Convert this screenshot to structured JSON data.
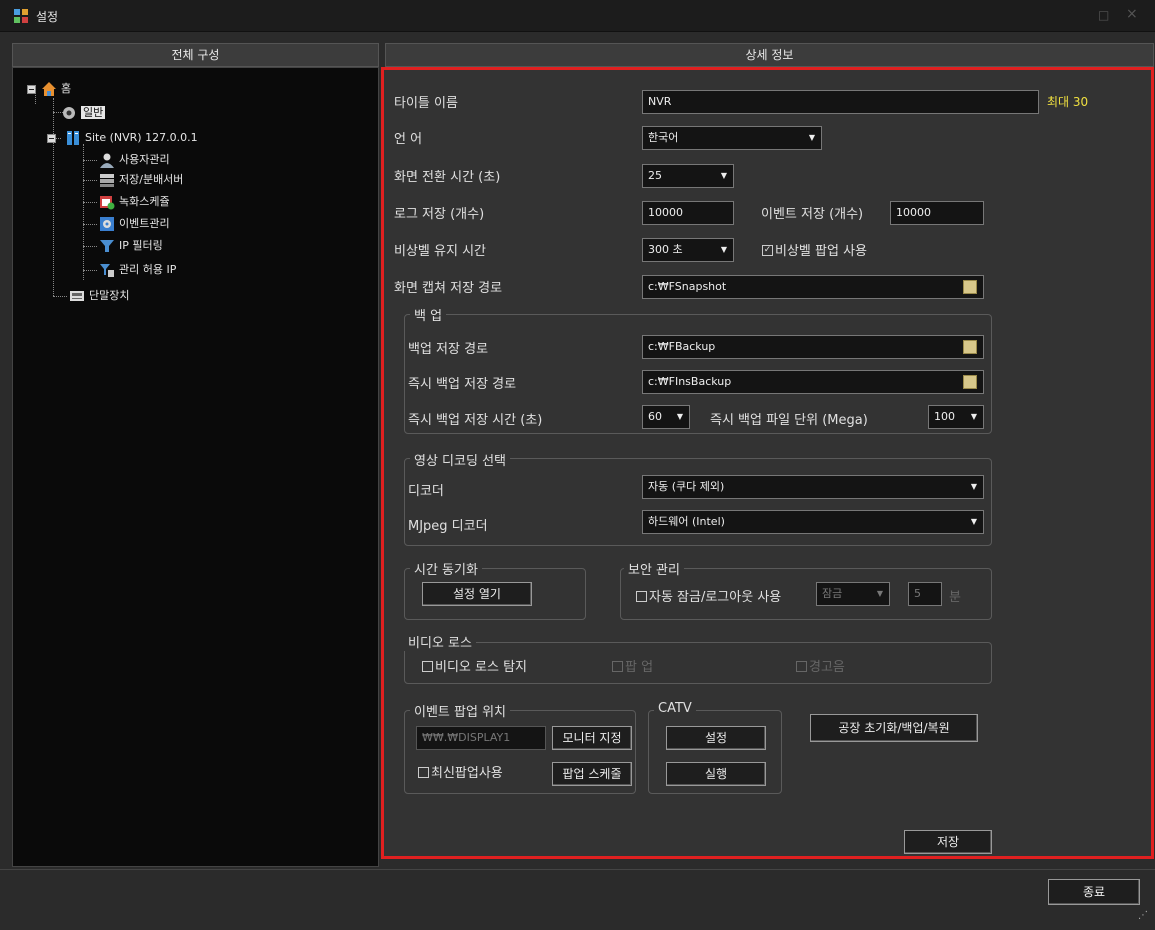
{
  "window": {
    "title": "설정",
    "minimize": "□",
    "close": "×"
  },
  "left_header": "전체 구성",
  "right_header": "상세 정보",
  "tree": {
    "root": "홈",
    "general": "일반",
    "site": "Site (NVR) 127.0.0.1",
    "user_mgmt": "사용자관리",
    "storage": "저장/분배서버",
    "rec_schedule": "녹화스케쥴",
    "event_mgmt": "이벤트관리",
    "ip_filter": "IP 필터링",
    "allowed_ip": "관리 허용 IP",
    "terminal": "단말장치"
  },
  "form": {
    "title_name_label": "타이틀 이름",
    "title_name_value": "NVR",
    "title_name_max": "최대 30",
    "language_label": "언 어",
    "language_value": "한국어",
    "screen_switch_label": "화면 전환 시간 (초)",
    "screen_switch_value": "25",
    "log_store_label": "로그 저장 (개수)",
    "log_store_value": "10000",
    "event_store_label": "이벤트 저장 (개수)",
    "event_store_value": "10000",
    "emergency_label": "비상벨 유지 시간",
    "emergency_value": "300 초",
    "emergency_popup": "비상벨 팝업 사용",
    "capture_path_label": "화면 캡쳐 저장 경로",
    "capture_path_value": "c:₩FSnapshot"
  },
  "backup": {
    "title": "백 업",
    "path_label": "백업 저장 경로",
    "path_value": "c:₩FBackup",
    "instant_path_label": "즉시 백업 저장 경로",
    "instant_path_value": "c:₩FInsBackup",
    "instant_time_label": "즉시 백업 저장 시간 (초)",
    "instant_time_value": "60",
    "file_unit_label": "즉시 백업 파일 단위 (Mega)",
    "file_unit_value": "100"
  },
  "decoding": {
    "title": "영상 디코딩 선택",
    "decoder_label": "디코더",
    "decoder_value": "자동 (쿠다 제외)",
    "mjpeg_label": "MJpeg 디코더",
    "mjpeg_value": "하드웨어 (Intel)"
  },
  "timesync": {
    "title": "시간 동기화",
    "open_btn": "설정 열기"
  },
  "security": {
    "title": "보안 관리",
    "auto_lock": "자동 잠금/로그아웃 사용",
    "lock_value": "잠금",
    "minutes_value": "5",
    "minutes_unit": "분"
  },
  "videoloss": {
    "title": "비디오 로스",
    "detect": "비디오 로스 탐지",
    "popup": "팝 업",
    "alarm": "경고음"
  },
  "eventpopup": {
    "title": "이벤트 팝업 위치",
    "display_value": "₩₩.₩DISPLAY1",
    "monitor_btn": "모니터 지정",
    "latest": "최신팝업사용",
    "schedule_btn": "팝업 스케줄"
  },
  "catv": {
    "title": "CATV",
    "setup_btn": "설정",
    "run_btn": "실행"
  },
  "factory_btn": "공장 초기화/백업/복원",
  "save_btn": "저장",
  "exit_btn": "종료",
  "colors": {
    "highlight_border": "#e02020",
    "max_hint": "#f0e040"
  }
}
